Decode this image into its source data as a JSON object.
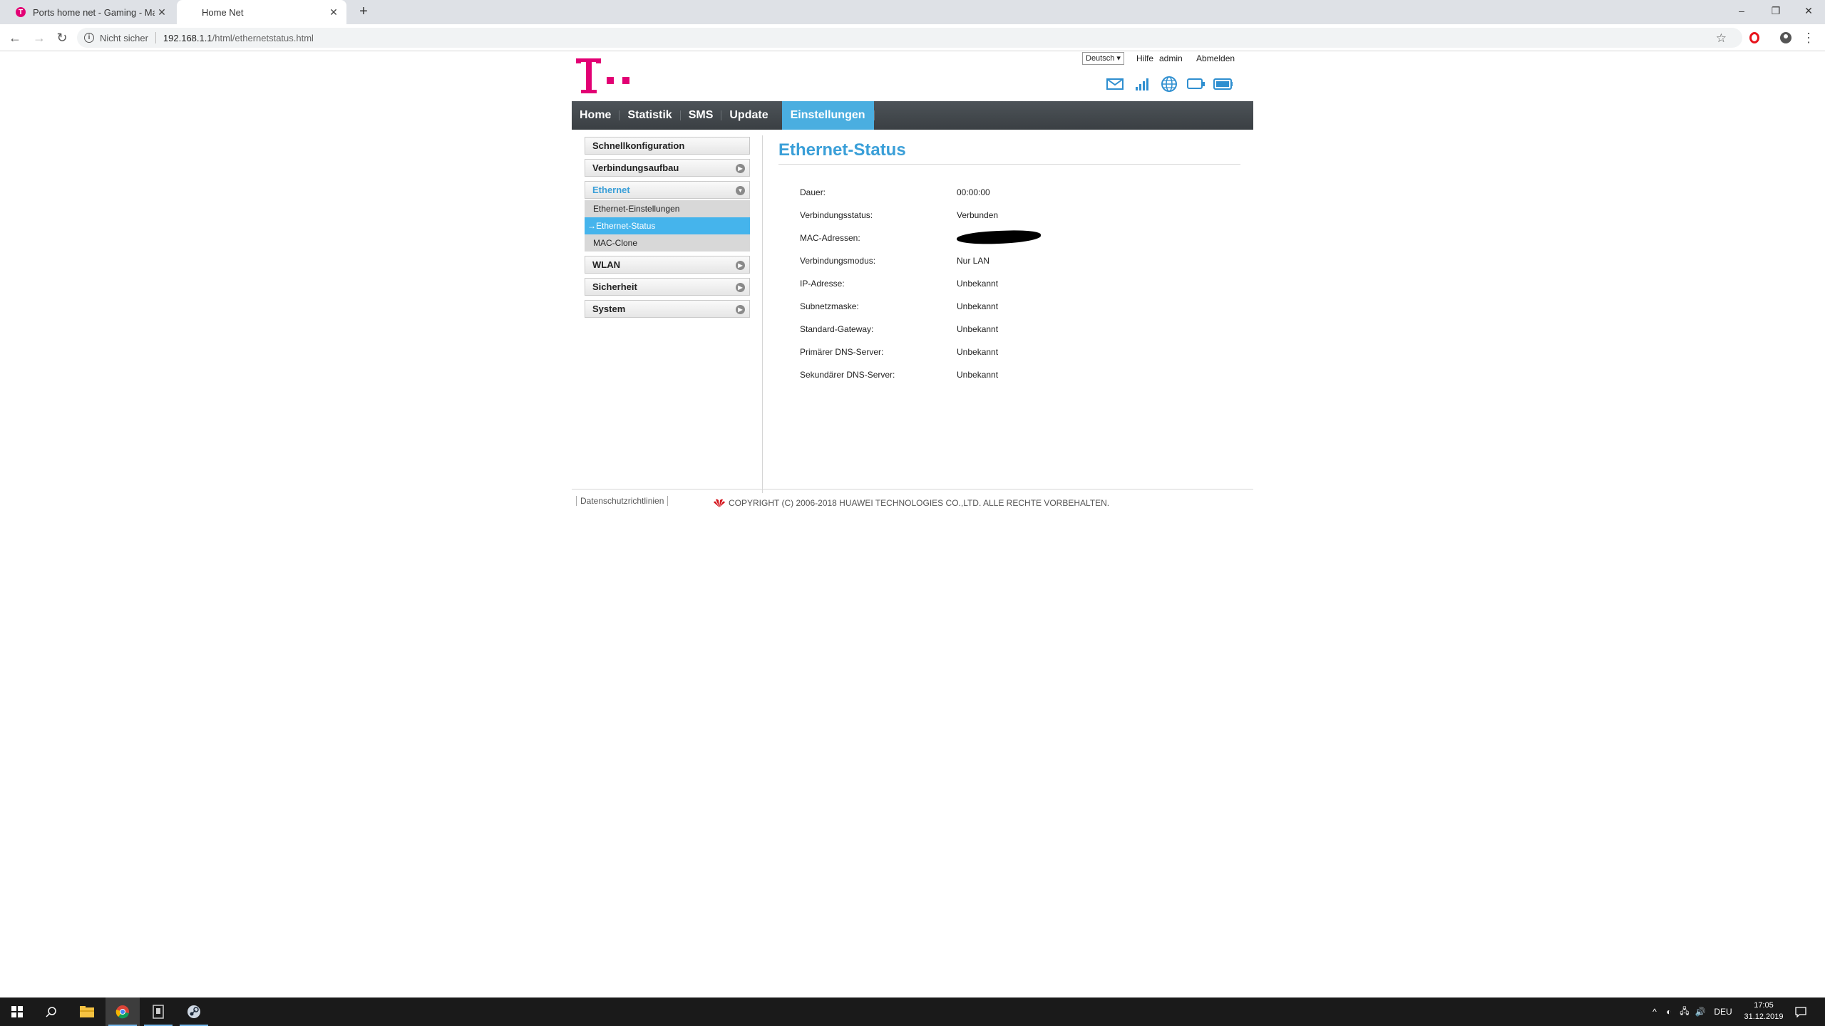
{
  "browser": {
    "tabs": [
      {
        "title": "Ports home net - Gaming - Mag",
        "favicon": "T"
      },
      {
        "title": "Home Net"
      }
    ],
    "security_label": "Nicht sicher",
    "url_host": "192.168.1.1",
    "url_path": "/html/ethernetstatus.html"
  },
  "router": {
    "language": "Deutsch",
    "top_links": {
      "help": "Hilfe",
      "user": "admin",
      "logout": "Abmelden"
    },
    "brand_color": "#e20074",
    "accent_color": "#4aaee0",
    "nav": [
      "Home",
      "Statistik",
      "SMS",
      "Update",
      "Einstellungen"
    ],
    "sidebar": {
      "quick": "Schnellkonfiguration",
      "connection": "Verbindungsaufbau",
      "ethernet": "Ethernet",
      "ethernet_sub": [
        "Ethernet-Einstellungen",
        "→Ethernet-Status",
        "MAC-Clone"
      ],
      "wlan": "WLAN",
      "security": "Sicherheit",
      "system": "System"
    },
    "page_title": "Ethernet-Status",
    "info": [
      {
        "label": "Dauer:",
        "value": "00:00:00"
      },
      {
        "label": "Verbindungsstatus:",
        "value": "Verbunden"
      },
      {
        "label": "MAC-Adressen:",
        "value": ""
      },
      {
        "label": "Verbindungsmodus:",
        "value": "Nur LAN"
      },
      {
        "label": "IP-Adresse:",
        "value": "Unbekannt"
      },
      {
        "label": "Subnetzmaske:",
        "value": "Unbekannt"
      },
      {
        "label": "Standard-Gateway:",
        "value": "Unbekannt"
      },
      {
        "label": "Primärer DNS-Server:",
        "value": "Unbekannt"
      },
      {
        "label": "Sekundärer DNS-Server:",
        "value": "Unbekannt"
      }
    ],
    "footer": {
      "privacy": "Datenschutzrichtlinien",
      "copyright": "COPYRIGHT (C) 2006-2018 HUAWEI TECHNOLOGIES CO.,LTD. ALLE RECHTE VORBEHALTEN."
    }
  },
  "taskbar": {
    "language": "DEU",
    "time": "17:05",
    "date": "31.12.2019"
  }
}
